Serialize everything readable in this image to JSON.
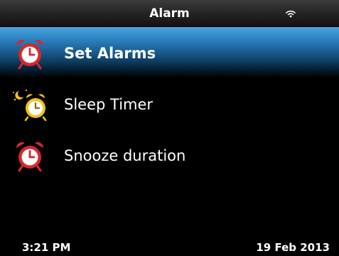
{
  "title_bar": {
    "title": "Alarm",
    "wifi_icon": "wifi-signal-icon"
  },
  "menu": {
    "items": [
      {
        "label": "Set Alarms",
        "icon": "alarm-clock-icon",
        "icon_color": "#d8262e",
        "selected": true
      },
      {
        "label": "Sleep Timer",
        "icon": "sleep-alarm-clock-icon",
        "icon_color": "#f2c21a",
        "selected": false
      },
      {
        "label": "Snooze duration",
        "icon": "snooze-alarm-clock-icon",
        "icon_color": "#d8262e",
        "selected": false
      }
    ]
  },
  "status_bar": {
    "time": "3:21 PM",
    "date": "19 Feb 2013"
  },
  "colors": {
    "selection_highlight": "#2d85c4",
    "background": "#000000",
    "text": "#ffffff"
  }
}
